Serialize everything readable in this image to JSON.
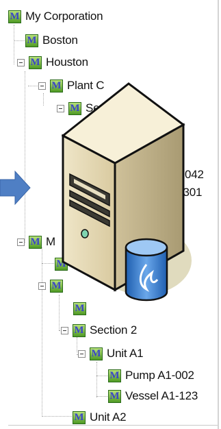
{
  "tree": {
    "root": {
      "label": "My Corporation",
      "icon": "model-icon",
      "icon_glyph": "M"
    },
    "boston": {
      "label": "Boston",
      "icon": "model-icon",
      "icon_glyph": "M"
    },
    "houston": {
      "label": "Houston",
      "icon": "model-icon",
      "icon_glyph": "M"
    },
    "plant_c": {
      "label": "Plant C",
      "icon": "model-icon",
      "icon_glyph": "M"
    },
    "section_partial": {
      "label": "Sec",
      "icon": "model-icon",
      "icon_glyph": "M"
    },
    "item_042": {
      "label": "042"
    },
    "item_301": {
      "label": "-301"
    },
    "m_partial": {
      "label": "M",
      "icon": "model-icon",
      "icon_glyph": "M"
    },
    "section_2": {
      "label": "Section 2",
      "icon": "model-icon",
      "icon_glyph": "M"
    },
    "unit_a1": {
      "label": "Unit A1",
      "icon": "model-icon",
      "icon_glyph": "M"
    },
    "pump": {
      "label": "Pump A1-002",
      "icon": "model-icon",
      "icon_glyph": "M"
    },
    "vessel": {
      "label": "Vessel A1-123",
      "icon": "model-icon",
      "icon_glyph": "M"
    },
    "unit_a2": {
      "label": "Unit A2",
      "icon": "model-icon",
      "icon_glyph": "M"
    }
  },
  "overlay": {
    "server_icon": "server-with-database-icon",
    "arrow_icon": "right-arrow-icon"
  },
  "colors": {
    "icon_green": "#4f9a24",
    "icon_letter": "#3a44c8",
    "arrow": "#4f7fc4",
    "db_blue": "#3e7fd0"
  }
}
